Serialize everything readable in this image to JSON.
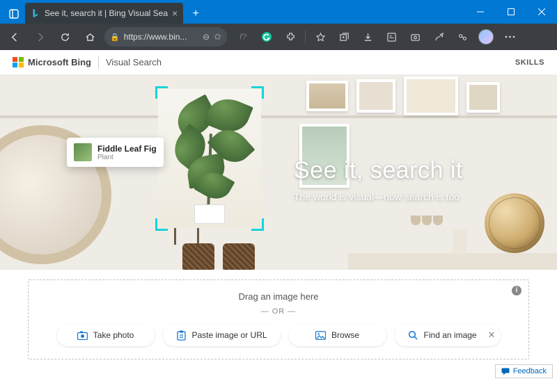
{
  "window": {
    "tab_title": "See it, search it | Bing Visual Sea",
    "url_display": "https://www.bin..."
  },
  "header": {
    "brand": "Microsoft Bing",
    "section": "Visual Search",
    "skills": "SKILLS"
  },
  "callout": {
    "title": "Fiddle Leaf Fig",
    "subtitle": "Plant"
  },
  "hero": {
    "headline": "See it, search it",
    "subline": "The world is visual—now search is too"
  },
  "dropzone": {
    "drag_label": "Drag an image here",
    "or_label": "— OR —",
    "take_photo": "Take photo",
    "paste": "Paste image or URL",
    "browse": "Browse",
    "find": "Find an image"
  },
  "feedback": {
    "label": "Feedback"
  }
}
